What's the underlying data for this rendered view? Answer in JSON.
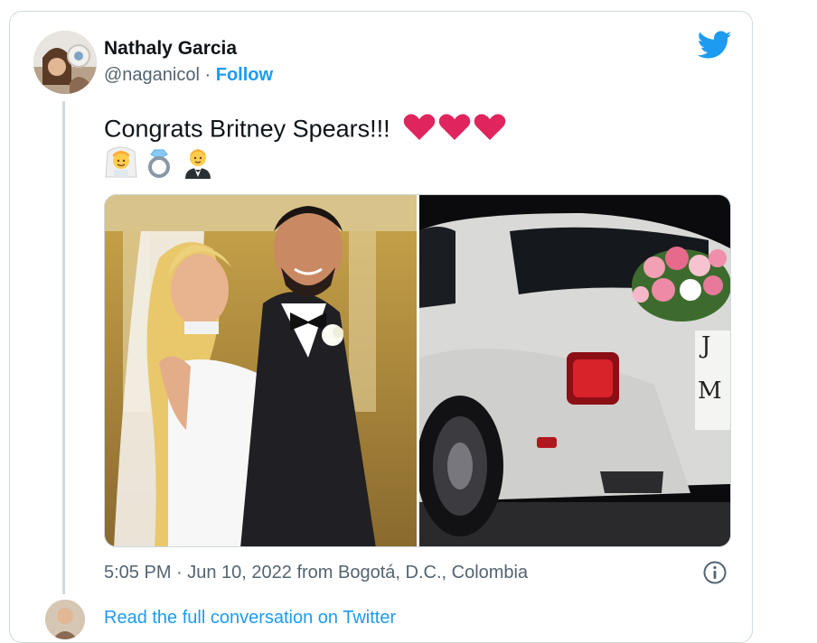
{
  "tweet": {
    "author_name": "Nathaly Garcia",
    "handle": "@naganicol",
    "separator": "·",
    "follow_label": "Follow",
    "text": "Congrats Britney Spears!!!",
    "emojis": [
      "bride-with-veil",
      "ring",
      "man-in-tuxedo"
    ],
    "timestamp": "5:05 PM · Jun 10, 2022 from Bogotá, D.C., Colombia",
    "icons": [
      "twitter-bird-icon",
      "info-icon",
      "heart-icon"
    ],
    "media_count": 2
  },
  "below": {
    "truncated_text": "Read the full conversation on Twitter"
  },
  "colors": {
    "accent": "#1d9bf0",
    "text": "#0f1419",
    "muted": "#536471",
    "border": "#cfd9de",
    "heart": "#e0245e"
  }
}
